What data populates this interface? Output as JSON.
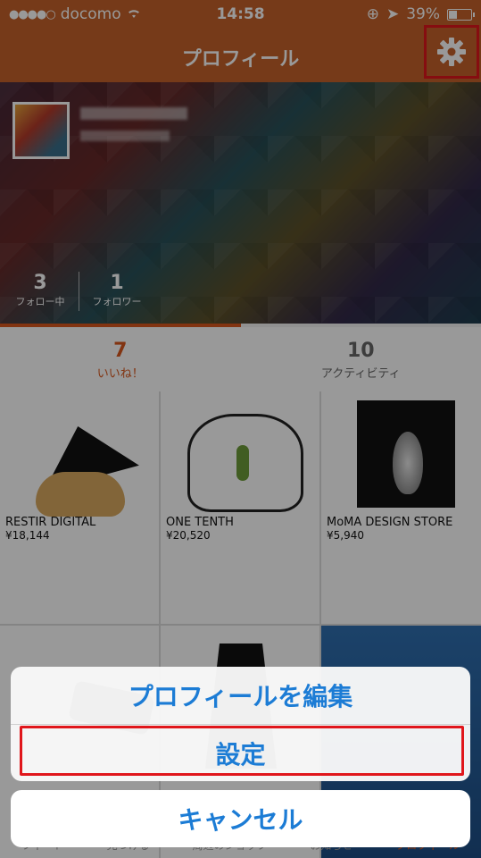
{
  "status_bar": {
    "carrier": "docomo",
    "time": "14:58",
    "battery": "39%"
  },
  "nav": {
    "title": "プロフィール"
  },
  "profile": {
    "stats": [
      {
        "value": "3",
        "label": "フォロー中"
      },
      {
        "value": "1",
        "label": "フォロワー"
      }
    ]
  },
  "tabs": [
    {
      "value": "7",
      "label": "いいね！"
    },
    {
      "value": "10",
      "label": "アクティビティ"
    }
  ],
  "items": [
    {
      "name": "RESTIR DIGITAL",
      "price": "¥18,144"
    },
    {
      "name": "ONE TENTH",
      "price": "¥20,520"
    },
    {
      "name": "MoMA DESIGN STORE",
      "price": "¥5,940"
    }
  ],
  "tabbar": {
    "items": [
      "フィード",
      "見つける",
      "周辺のショップ",
      "お知らせ",
      "プロフィール"
    ]
  },
  "action_sheet": {
    "edit_profile": "プロフィールを編集",
    "settings": "設定",
    "cancel": "キャンセル"
  },
  "colors": {
    "brand": "#c5612a",
    "accent": "#d9581d",
    "highlight": "#e0161b",
    "ios_blue": "#1c7cd5"
  }
}
